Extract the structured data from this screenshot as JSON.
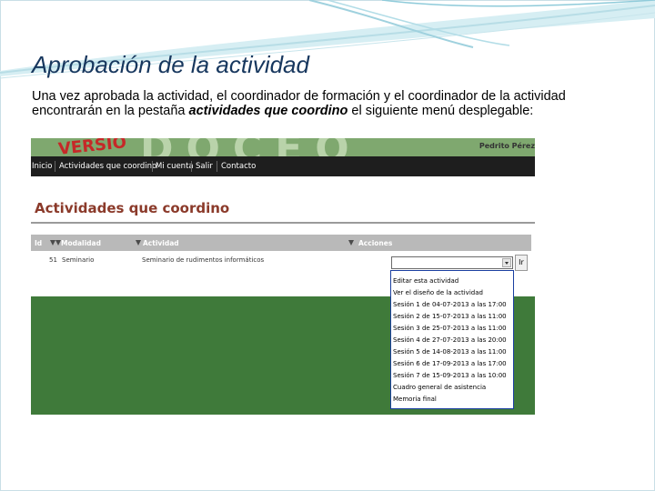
{
  "slide": {
    "title": "Aprobación de la actividad",
    "body_before": "Una vez aprobada la actividad, el coordinador de formación y el coordinador de la actividad encontrarán en la pestaña ",
    "body_emphasis": "actividades que coordino",
    "body_after": " el siguiente menú desplegable:"
  },
  "screenshot": {
    "banner": {
      "version_text": "VERSIÓ",
      "deco_text": "DOCEO",
      "user_name": "Pedrito Pérez"
    },
    "nav": [
      "Inicio",
      "Actividades que coordino",
      "Mi cuenta",
      "Salir",
      "Contacto"
    ],
    "heading": "Actividades que coordino",
    "table": {
      "headers": [
        "Id",
        "Modalidad",
        "Actividad",
        "Acciones"
      ],
      "row": {
        "id": "51",
        "modalidad": "Seminario",
        "actividad": "Seminario de rudimentos informáticos"
      }
    },
    "go_button_label": "Ir",
    "dropdown_options": [
      "Editar esta actividad",
      "Ver el diseño de la actividad",
      "Sesión 1 de 04-07-2013 a las 17:00",
      "Sesión 2 de 15-07-2013 a las 11:00",
      "Sesión 3 de 25-07-2013 a las 11:00",
      "Sesión 4 de 27-07-2013 a las 20:00",
      "Sesión 5 de 14-08-2013 a las 11:00",
      "Sesión 6 de 17-09-2013 a las 17:00",
      "Sesión 7 de 15-09-2013 a las 10:00",
      "Cuadro general de asistencia",
      "Memoria final"
    ]
  },
  "colors": {
    "title": "#17375e",
    "heading": "#8b3a2a",
    "page_green": "#3f7a3a",
    "navbar": "#1e1e1e",
    "dropdown_highlight": "#3a6fd8"
  }
}
